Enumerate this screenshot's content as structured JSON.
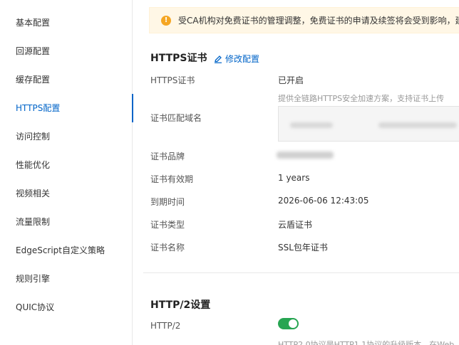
{
  "sidebar": {
    "items": [
      {
        "label": "基本配置"
      },
      {
        "label": "回源配置"
      },
      {
        "label": "缓存配置"
      },
      {
        "label": "HTTPS配置"
      },
      {
        "label": "访问控制"
      },
      {
        "label": "性能优化"
      },
      {
        "label": "视频相关"
      },
      {
        "label": "流量限制"
      },
      {
        "label": "EdgeScript自定义策略"
      },
      {
        "label": "规则引擎"
      },
      {
        "label": "QUIC协议"
      }
    ],
    "active_index": 3
  },
  "banner": {
    "icon": "exclamation-icon",
    "text": "受CA机构对免费证书的管理调整，免费证书的申请及续签将会受到影响，建"
  },
  "https_section": {
    "title": "HTTPS证书",
    "edit_label": "修改配置",
    "rows": {
      "https_cert": {
        "label": "HTTPS证书",
        "value": "已开启",
        "hint": "提供全链路HTTPS安全加速方案，支持证书上传"
      },
      "domain_match": {
        "label": "证书匹配域名"
      },
      "brand": {
        "label": "证书品牌"
      },
      "validity": {
        "label": "证书有效期",
        "value": "1 years"
      },
      "expiry": {
        "label": "到期时间",
        "value": "2026-06-06 12:43:05"
      },
      "type": {
        "label": "证书类型",
        "value": "云盾证书"
      },
      "name": {
        "label": "证书名称",
        "value": "SSL包年证书"
      }
    }
  },
  "http2_section": {
    "title": "HTTP/2设置",
    "http2": {
      "label": "HTTP/2",
      "enabled": true
    },
    "hint": "HTTP2.0协议是HTTP1.1协议的升级版本，在Web"
  },
  "colors": {
    "accent": "#0064c8",
    "toggle_on": "#27a552",
    "warning": "#f5a623"
  }
}
